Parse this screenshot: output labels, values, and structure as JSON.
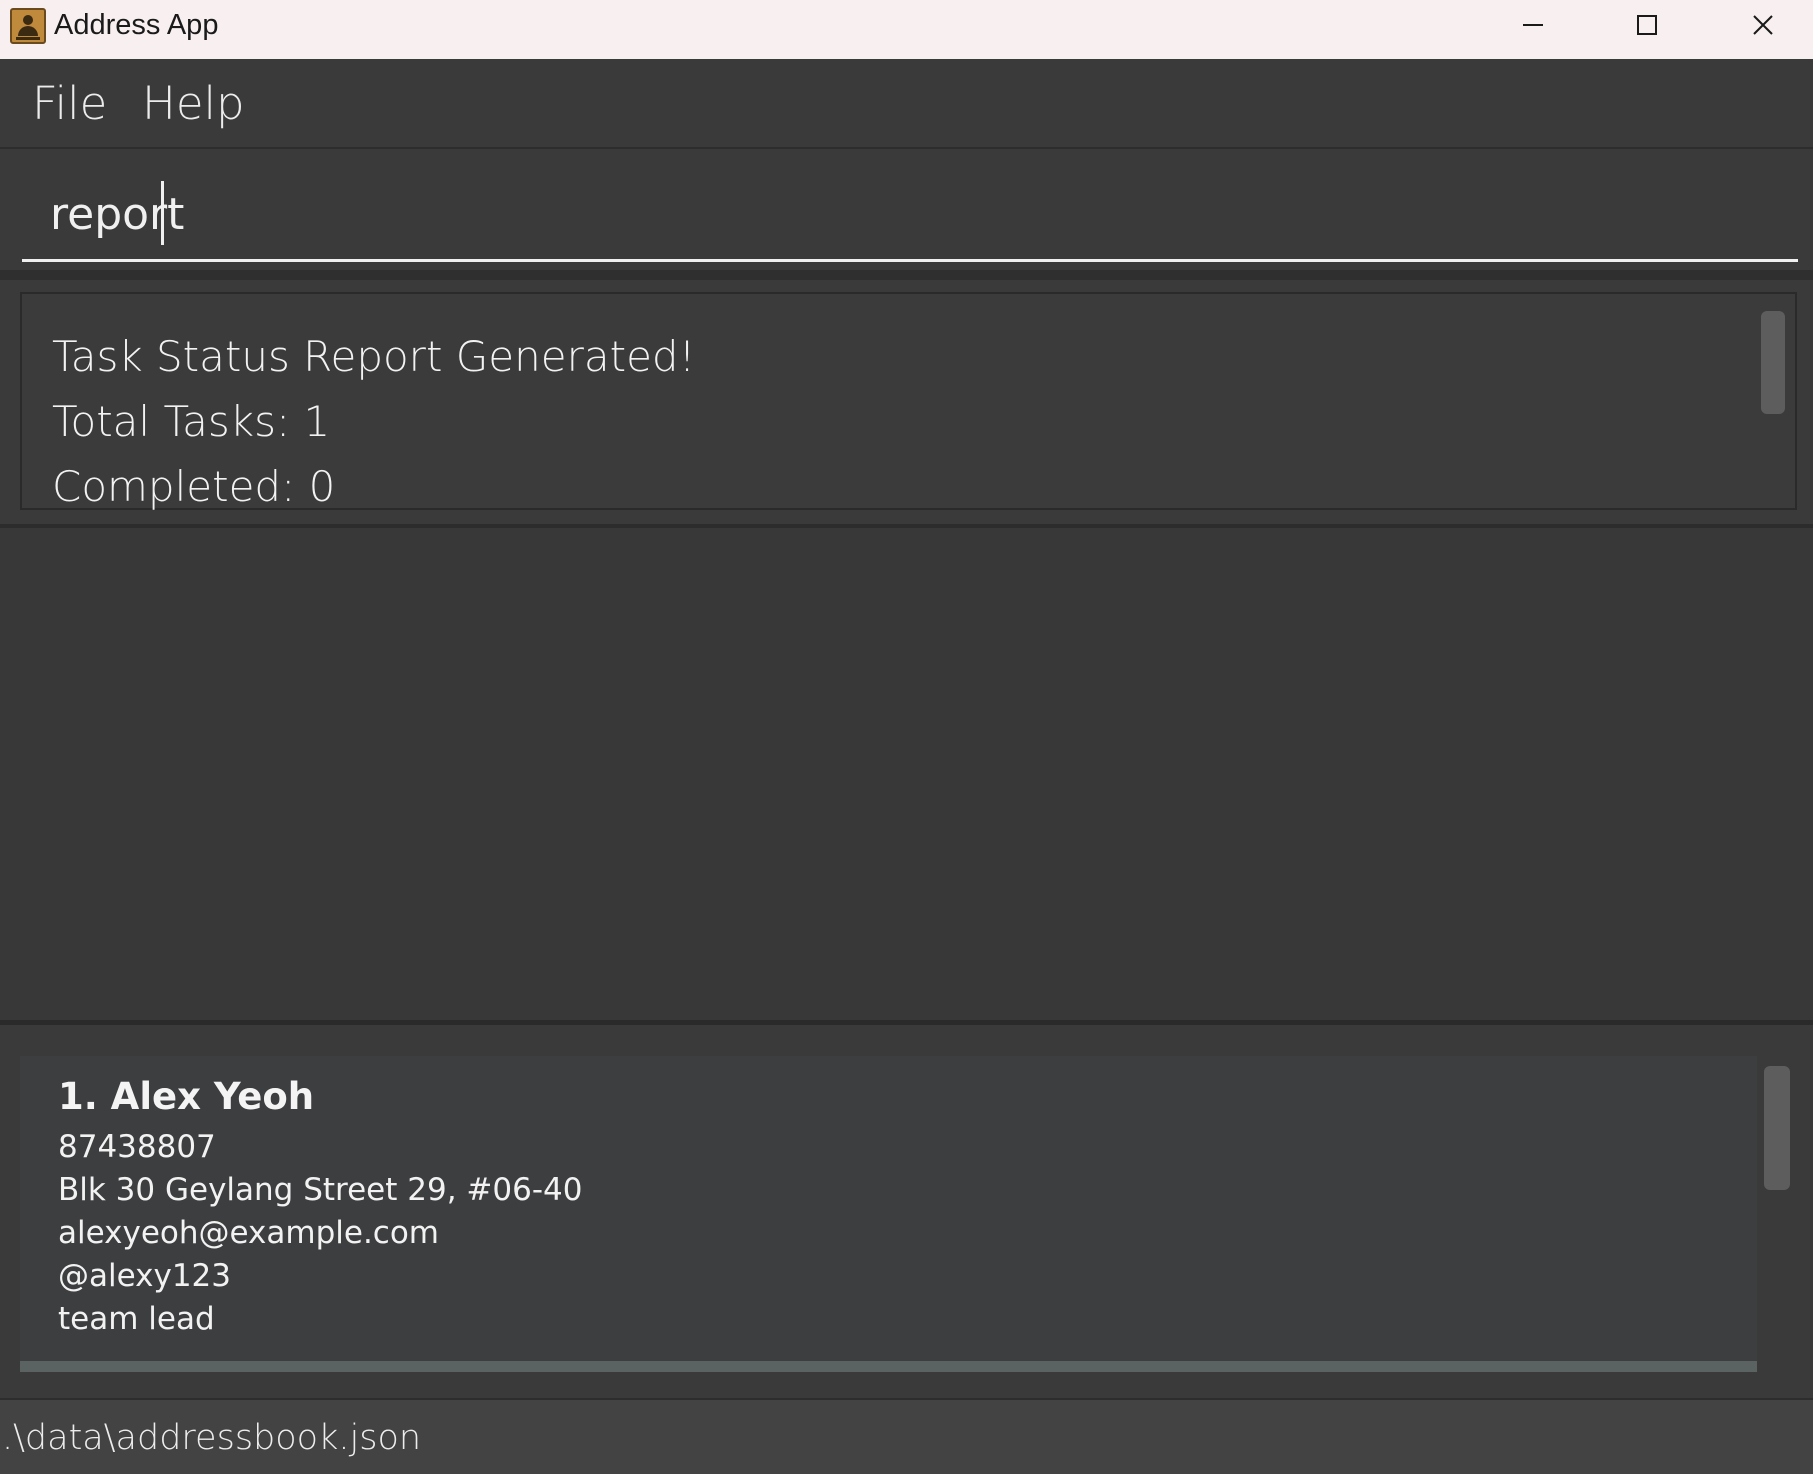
{
  "window": {
    "title": "Address App",
    "icon": "address-book-icon",
    "controls": [
      "minimize-icon",
      "maximize-icon",
      "close-icon"
    ]
  },
  "menu": {
    "items": [
      {
        "label": "File"
      },
      {
        "label": "Help"
      }
    ]
  },
  "command": {
    "value": "report"
  },
  "result": {
    "lines": [
      "Task Status Report Generated!",
      "Total Tasks: 1",
      "Completed: 0"
    ]
  },
  "persons": [
    {
      "name": "1. Alex Yeoh",
      "phone": "87438807",
      "address": "Blk 30 Geylang Street 29, #06-40",
      "email": "alexyeoh@example.com",
      "handle": "@alexy123",
      "role": "team lead"
    }
  ],
  "status": {
    "path": ".\\data\\addressbook.json"
  },
  "colors": {
    "background": "#3a3a3a",
    "titlebar": "#f8f0f0",
    "card": "#3d3e40",
    "card_border": "#5a6262",
    "text": "#f2f2f2"
  }
}
